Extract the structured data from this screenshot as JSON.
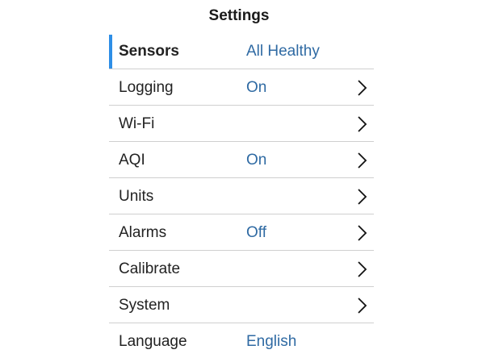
{
  "header": {
    "title": "Settings"
  },
  "colors": {
    "accent": "#2e8ee6",
    "value_text": "#2f6aa3",
    "divider": "#cfcfcf"
  },
  "menu": {
    "items": [
      {
        "label": "Sensors",
        "value": "All Healthy",
        "chevron": false,
        "active": true,
        "icon": ""
      },
      {
        "label": "Logging",
        "value": "On",
        "chevron": true,
        "active": false,
        "icon": "chevron-right-icon"
      },
      {
        "label": "Wi-Fi",
        "value": "",
        "chevron": true,
        "active": false,
        "icon": "chevron-right-icon"
      },
      {
        "label": "AQI",
        "value": "On",
        "chevron": true,
        "active": false,
        "icon": "chevron-right-icon"
      },
      {
        "label": "Units",
        "value": "",
        "chevron": true,
        "active": false,
        "icon": "chevron-right-icon"
      },
      {
        "label": "Alarms",
        "value": "Off",
        "chevron": true,
        "active": false,
        "icon": "chevron-right-icon"
      },
      {
        "label": "Calibrate",
        "value": "",
        "chevron": true,
        "active": false,
        "icon": "chevron-right-icon"
      },
      {
        "label": "System",
        "value": "",
        "chevron": true,
        "active": false,
        "icon": "chevron-right-icon"
      },
      {
        "label": "Language",
        "value": "English",
        "chevron": false,
        "active": false,
        "icon": ""
      }
    ]
  }
}
